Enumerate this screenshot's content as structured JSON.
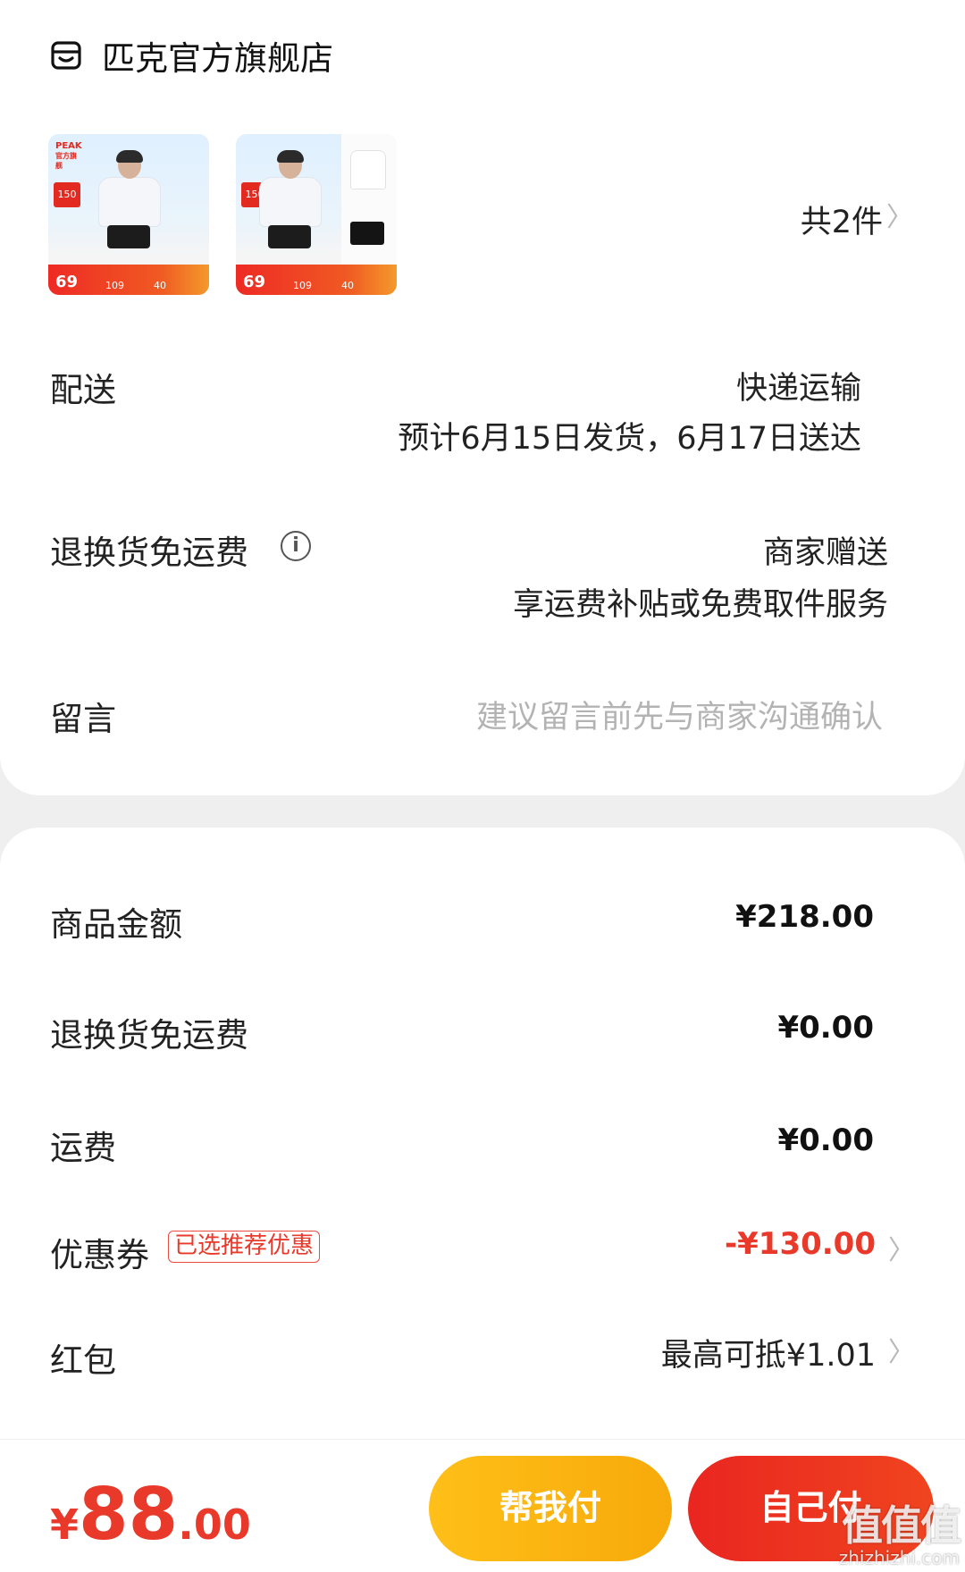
{
  "shop": {
    "name": "匹克官方旗舰店"
  },
  "items": {
    "count_label": "共2件",
    "thumbnails": [
      {
        "brand": "PEAK",
        "brand_sub": "官方旗舰",
        "tag": "150",
        "prices": [
          "69",
          "109",
          "40"
        ]
      },
      {
        "brand": "",
        "brand_sub": "",
        "tag": "150",
        "prices": [
          "69",
          "109",
          "40"
        ]
      }
    ]
  },
  "delivery": {
    "label": "配送",
    "method": "快递运输",
    "estimate": "预计6月15日发货，6月17日送达"
  },
  "return_shipping": {
    "label": "退换货免运费",
    "value": "商家赠送",
    "desc": "享运费补贴或免费取件服务"
  },
  "message": {
    "label": "留言",
    "placeholder": "建议留言前先与商家沟通确认"
  },
  "summary": {
    "goods_amount": {
      "label": "商品金额",
      "value": "¥218.00"
    },
    "return_fee": {
      "label": "退换货免运费",
      "value": "¥0.00"
    },
    "shipping": {
      "label": "运费",
      "value": "¥0.00"
    },
    "coupon": {
      "label": "优惠券",
      "tag": "已选推荐优惠",
      "value": "-¥130.00"
    },
    "red_packet": {
      "label": "红包",
      "value": "最高可抵¥1.01"
    }
  },
  "footer": {
    "total_currency": "¥",
    "total_integer": "88",
    "total_decimal": ".00",
    "help_pay_label": "帮我付",
    "self_pay_label": "自己付"
  },
  "watermark": {
    "logo": "值值值",
    "url": "zhizhizhi.com"
  },
  "colors": {
    "accent_red": "#e8392a",
    "help_button_yellow": "#ffbf18",
    "self_button_red": "#e92620",
    "page_background": "#efefef"
  },
  "icons": [
    "shop-icon",
    "info-icon",
    "chevron-right-icon"
  ]
}
